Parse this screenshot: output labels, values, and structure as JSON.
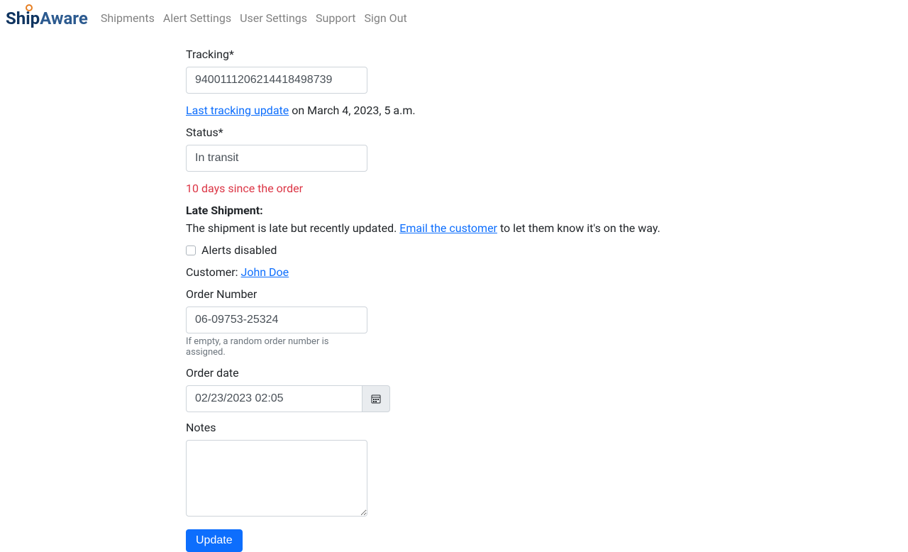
{
  "brand": {
    "ship": "Ship",
    "aware": "Aware"
  },
  "nav": {
    "shipments": "Shipments",
    "alert_settings": "Alert Settings",
    "user_settings": "User Settings",
    "support": "Support",
    "sign_out": "Sign Out"
  },
  "form": {
    "tracking_label": "Tracking*",
    "tracking_value": "9400111206214418498739",
    "last_update_link": "Last tracking update",
    "last_update_suffix": " on March 4, 2023, 5 a.m.",
    "status_label": "Status*",
    "status_value": "In transit",
    "days_warning": "10 days since the order",
    "late_title": "Late Shipment:",
    "late_prefix": "The shipment is late but recently updated. ",
    "late_link": "Email the customer",
    "late_suffix": " to let them know it's on the way.",
    "alerts_disabled_label": "Alerts disabled",
    "customer_prefix": "Customer: ",
    "customer_name": "John Doe",
    "order_number_label": "Order Number",
    "order_number_value": "06-09753-25324",
    "order_number_help": "If empty, a random order number is assigned.",
    "order_date_label": "Order date",
    "order_date_value": "02/23/2023 02:05",
    "notes_label": "Notes",
    "notes_value": "",
    "update_button": "Update"
  }
}
